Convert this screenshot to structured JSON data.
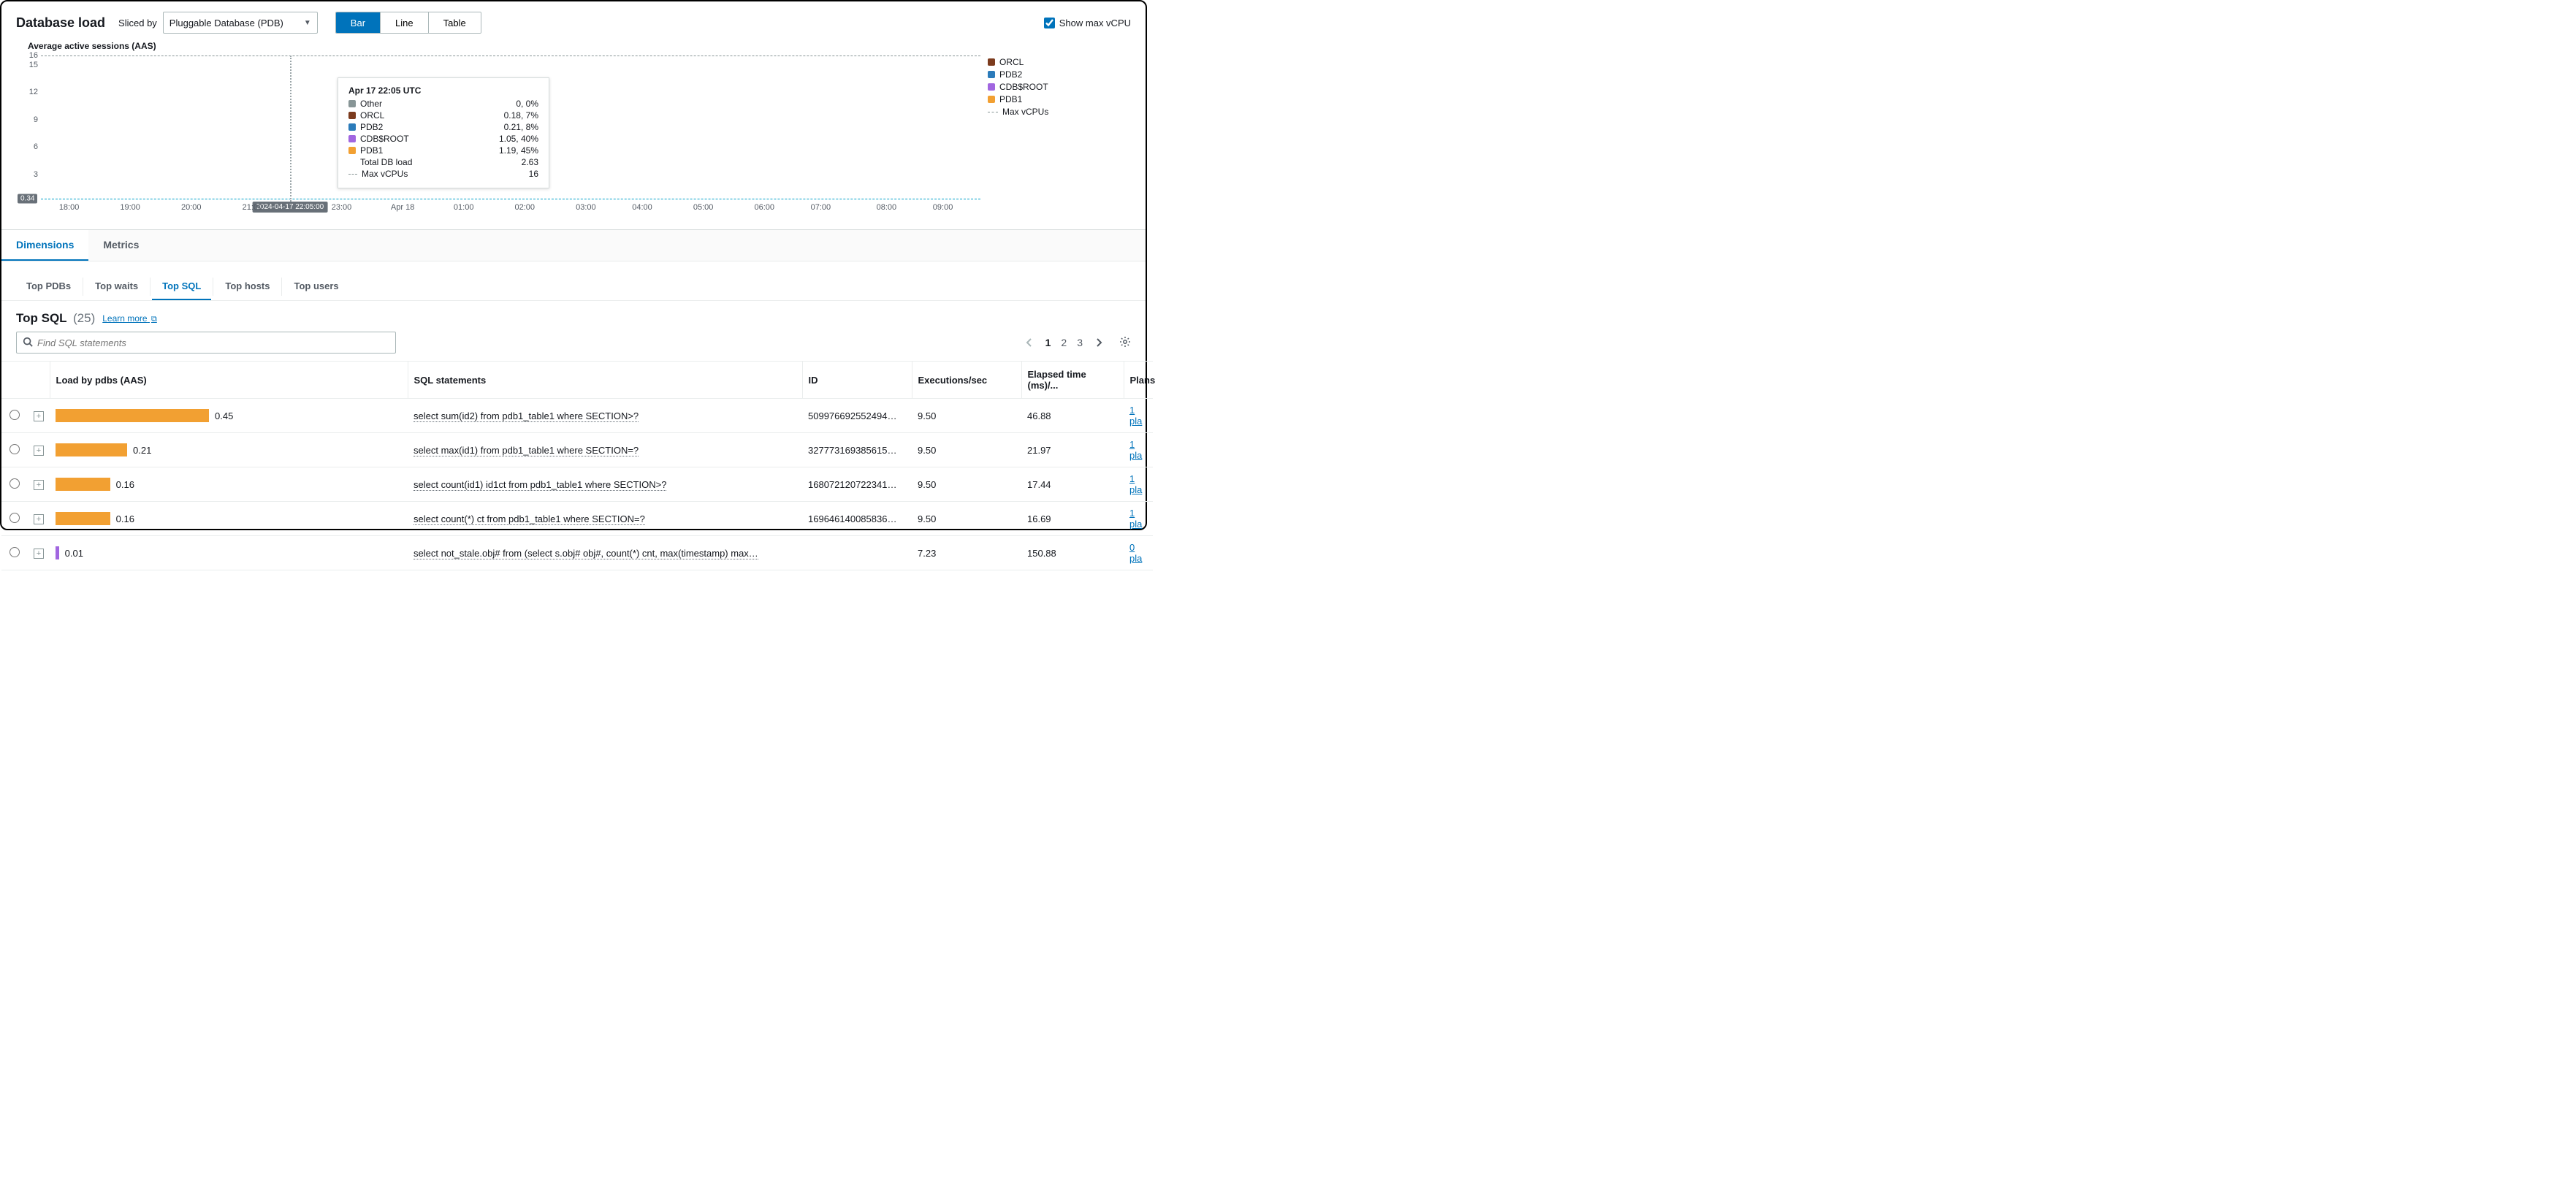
{
  "header": {
    "title": "Database load",
    "sliced_by_label": "Sliced by",
    "sliced_by_value": "Pluggable Database (PDB)",
    "views": {
      "bar": "Bar",
      "line": "Line",
      "table": "Table"
    },
    "show_max_vcpu": "Show max vCPU"
  },
  "chart_data": {
    "type": "bar",
    "title": "Average active sessions (AAS)",
    "ylabel": "",
    "ylim": [
      0,
      16
    ],
    "y_ticks": [
      3,
      6,
      9,
      12,
      15,
      16
    ],
    "x_ticks": [
      "18:00",
      "19:00",
      "20:00",
      "21:00",
      "23:00",
      "Apr 18",
      "01:00",
      "02:00",
      "03:00",
      "04:00",
      "05:00",
      "06:00",
      "07:00",
      "08:00",
      "09:00"
    ],
    "x_hover_label": "2024-04-17 22:05:00",
    "max_vcpus": 16,
    "current_total_marker": 0.34,
    "legend": [
      {
        "name": "ORCL",
        "color": "#7c3b1e"
      },
      {
        "name": "PDB2",
        "color": "#2b7bba"
      },
      {
        "name": "CDB$ROOT",
        "color": "#a166e0"
      },
      {
        "name": "PDB1",
        "color": "#f2a032"
      },
      {
        "name": "Max vCPUs",
        "dash": true
      }
    ],
    "series_at_hover": [
      {
        "name": "Other",
        "color": "#879596",
        "value": 0,
        "pct": "0%"
      },
      {
        "name": "ORCL",
        "color": "#7c3b1e",
        "value": 0.18,
        "pct": "7%"
      },
      {
        "name": "PDB2",
        "color": "#2b7bba",
        "value": 0.21,
        "pct": "8%"
      },
      {
        "name": "CDB$ROOT",
        "color": "#a166e0",
        "value": 1.05,
        "pct": "40%"
      },
      {
        "name": "PDB1",
        "color": "#f2a032",
        "value": 1.19,
        "pct": "45%"
      }
    ],
    "tooltip": {
      "title": "Apr 17 22:05 UTC",
      "rows": [
        {
          "label": "Other",
          "value": "0, 0%"
        },
        {
          "label": "ORCL",
          "value": "0.18, 7%"
        },
        {
          "label": "PDB2",
          "value": "0.21, 8%"
        },
        {
          "label": "CDB$ROOT",
          "value": "1.05, 40%"
        },
        {
          "label": "PDB1",
          "value": "1.19, 45%"
        },
        {
          "label": "Total DB load",
          "value": "2.63"
        },
        {
          "label": "Max vCPUs",
          "value": "16"
        }
      ]
    },
    "typical_bar_total": 0.34
  },
  "tabs1": {
    "dimensions": "Dimensions",
    "metrics": "Metrics"
  },
  "tabs2": {
    "top_pdbs": "Top PDBs",
    "top_waits": "Top waits",
    "top_sql": "Top SQL",
    "top_hosts": "Top hosts",
    "top_users": "Top users"
  },
  "section": {
    "title": "Top SQL",
    "count": "(25)",
    "learn_more": "Learn more"
  },
  "search": {
    "placeholder": "Find SQL statements"
  },
  "pager": {
    "pages": [
      "1",
      "2",
      "3"
    ],
    "current": "1"
  },
  "table": {
    "columns": {
      "load": "Load by pdbs (AAS)",
      "sql": "SQL statements",
      "id": "ID",
      "exec": "Executions/sec",
      "elapsed": "Elapsed time (ms)/...",
      "plans": "Plans"
    },
    "rows": [
      {
        "load": 0.45,
        "bar_color": "orange",
        "sql": "select sum(id2) from pdb1_table1 where SECTION>?",
        "id": "509976692552494…",
        "exec": "9.50",
        "elapsed": "46.88",
        "plans": "1 pla"
      },
      {
        "load": 0.21,
        "bar_color": "orange",
        "sql": "select max(id1) from pdb1_table1 where SECTION=?",
        "id": "327773169385615…",
        "exec": "9.50",
        "elapsed": "21.97",
        "plans": "1 pla"
      },
      {
        "load": 0.16,
        "bar_color": "orange",
        "sql": "select count(id1) id1ct from pdb1_table1 where SECTION>?",
        "id": "168072120722341…",
        "exec": "9.50",
        "elapsed": "17.44",
        "plans": "1 pla"
      },
      {
        "load": 0.16,
        "bar_color": "orange",
        "sql": "select count(*) ct from pdb1_table1 where SECTION=?",
        "id": "169646140085836…",
        "exec": "9.50",
        "elapsed": "16.69",
        "plans": "1 pla"
      },
      {
        "load": 0.01,
        "bar_color": "purple",
        "sql": "select not_stale.obj# from (select s.obj# obj#, count(*) cnt, max(timestamp) max…",
        "id": "",
        "exec": "7.23",
        "elapsed": "150.88",
        "plans": "0 pla"
      }
    ]
  },
  "colors": {
    "orcl": "#7c3b1e",
    "pdb2": "#2b7bba",
    "cdb": "#a166e0",
    "pdb1": "#f2a032",
    "other": "#879596"
  }
}
